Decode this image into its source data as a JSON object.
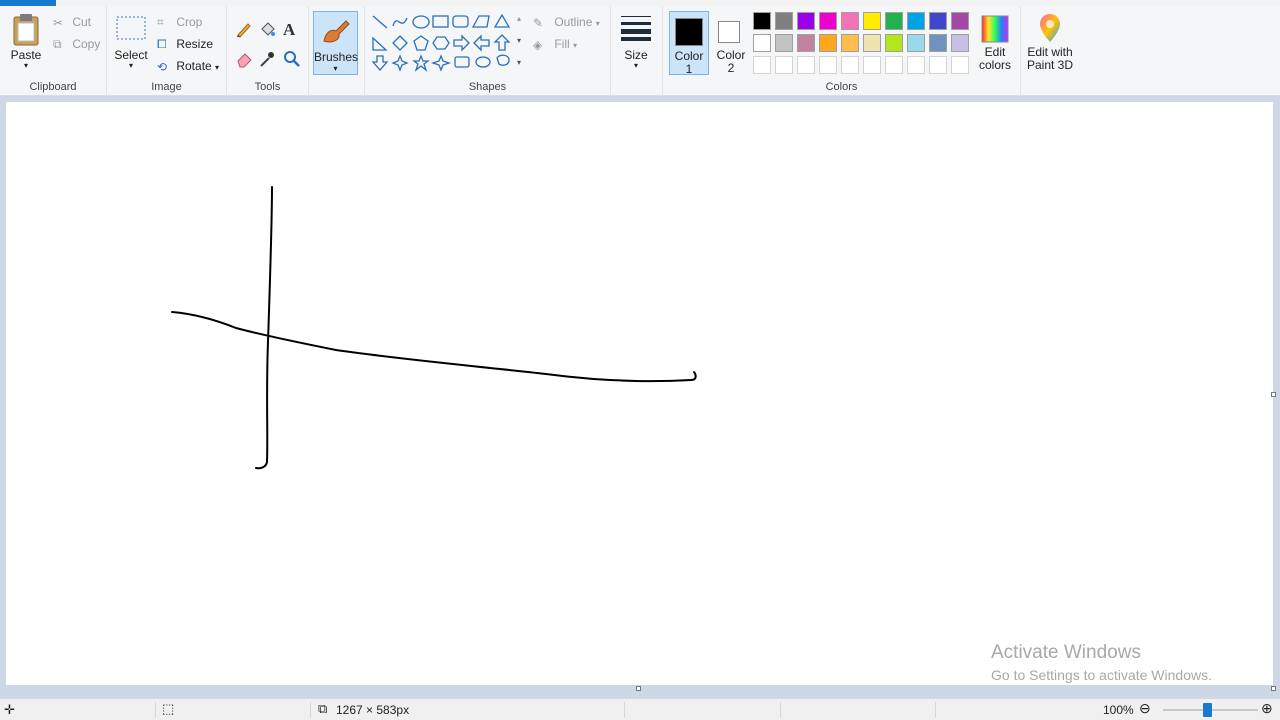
{
  "ribbon": {
    "clipboard": {
      "label": "Clipboard",
      "paste": "Paste",
      "cut": "Cut",
      "copy": "Copy"
    },
    "image": {
      "label": "Image",
      "select": "Select",
      "crop": "Crop",
      "resize": "Resize",
      "rotate": "Rotate"
    },
    "tools": {
      "label": "Tools"
    },
    "brushes": {
      "label": "Brushes"
    },
    "shapes": {
      "label": "Shapes",
      "outline": "Outline",
      "fill": "Fill"
    },
    "size": {
      "label": "Size"
    },
    "colors": {
      "label": "Colors",
      "color1_line1": "Color",
      "color1_line2": "1",
      "color2_line1": "Color",
      "color2_line2": "2",
      "edit_colors_line1": "Edit",
      "edit_colors_line2": "colors",
      "paint3d_line1": "Edit with",
      "paint3d_line2": "Paint 3D",
      "color1_value": "#000000",
      "color2_value": "#ffffff",
      "palette_row1": [
        "#000000",
        "#7f7f7f",
        "#9b00e8",
        "#ee00cf",
        "#f472b6",
        "#ffec00",
        "#22b14c",
        "#00a2e8",
        "#3f48cc",
        "#a349a4"
      ],
      "palette_row2": [
        "#ffffff",
        "#c3c3c3",
        "#c283a0",
        "#ffa71c",
        "#ffbd4d",
        "#efe4b0",
        "#b5e61d",
        "#99d9ea",
        "#7092be",
        "#c8bfe7"
      ],
      "palette_row3": [
        "#ffffff",
        "#ffffff",
        "#ffffff",
        "#ffffff",
        "#ffffff",
        "#ffffff",
        "#ffffff",
        "#ffffff",
        "#ffffff",
        "#ffffff"
      ]
    }
  },
  "status": {
    "dimensions": "1267 × 583px",
    "zoom": "100%"
  },
  "watermark": {
    "line1": "Activate Windows",
    "line2": "Go to Settings to activate Windows."
  }
}
